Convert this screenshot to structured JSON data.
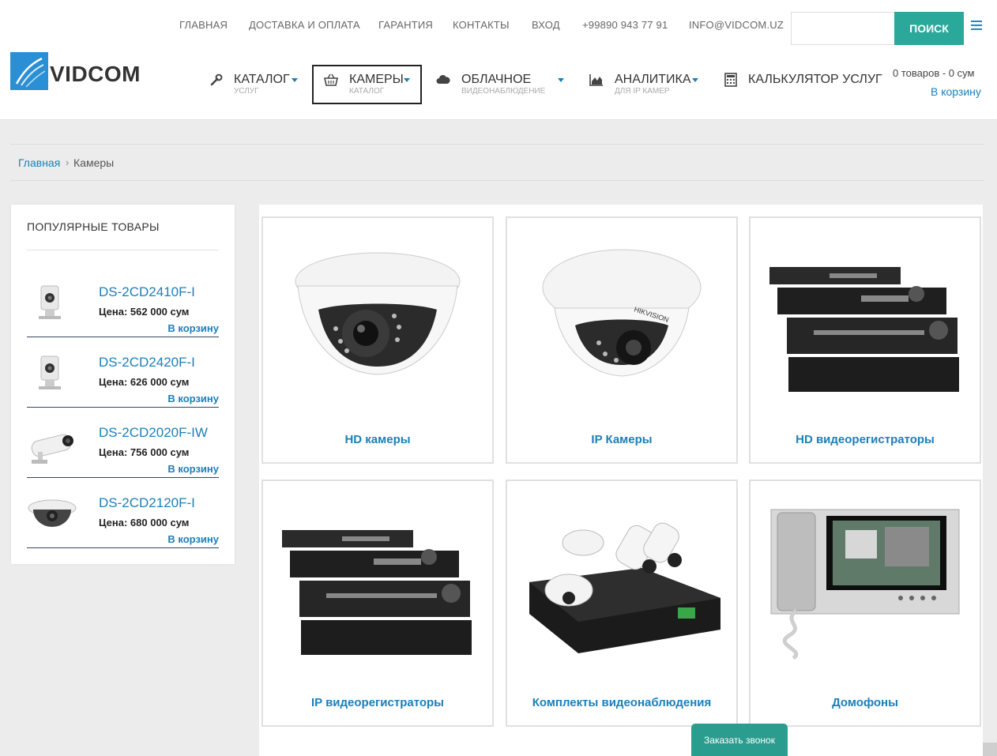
{
  "topnav": {
    "home": "ГЛАВНАЯ",
    "delivery": "ДОСТАВКА И ОПЛАТА",
    "warranty": "ГАРАНТИЯ",
    "contacts": "КОНТАКТЫ",
    "login": "ВХОД",
    "phone": "+99890 943 77 91",
    "email": "INFO@VIDCOM.UZ"
  },
  "search": {
    "placeholder": "",
    "button": "ПОИСК"
  },
  "logo": {
    "text": "VIDCOM"
  },
  "mainnav": {
    "catalog": {
      "label": "КАТАЛОГ",
      "sub": "УСЛУГ",
      "icon": "wrench-icon"
    },
    "cameras": {
      "label": "КАМЕРЫ",
      "sub": "КАТАЛОГ",
      "icon": "basket-icon"
    },
    "cloud": {
      "label": "ОБЛАЧНОЕ",
      "sub": "ВИДЕОНАБЛЮДЕНИЕ",
      "icon": "cloud-icon"
    },
    "analytics": {
      "label": "АНАЛИТИКА",
      "sub": "ДЛЯ IP КАМЕР",
      "icon": "area-chart-icon"
    },
    "calculator": {
      "label": "КАЛЬКУЛЯТОР УСЛУГ",
      "icon": "calculator-icon"
    }
  },
  "cart": {
    "summary": "0  товаров - 0 сум",
    "link": "В корзину"
  },
  "breadcrumb": {
    "home": "Главная",
    "separator": "›",
    "current": "Камеры"
  },
  "sidebar": {
    "title": "ПОПУЛЯРНЫЕ ТОВАРЫ",
    "products": [
      {
        "name": "DS-2CD2410F-I",
        "price": "Цена: 562 000 сум",
        "cart": "В корзину"
      },
      {
        "name": "DS-2CD2420F-I",
        "price": "Цена: 626 000 сум",
        "cart": "В корзину"
      },
      {
        "name": "DS-2CD2020F-IW",
        "price": "Цена: 756 000 сум",
        "cart": "В корзину"
      },
      {
        "name": "DS-2CD2120F-I",
        "price": "Цена: 680 000 сум",
        "cart": "В корзину"
      }
    ]
  },
  "categories": [
    {
      "label": "HD камеры"
    },
    {
      "label": "IP Камеры"
    },
    {
      "label": "HD видеорегистраторы"
    },
    {
      "label": "IP видеорегистраторы"
    },
    {
      "label": "Комплекты видеонаблюдения"
    },
    {
      "label": "Домофоны"
    }
  ],
  "callback": {
    "label": "Заказать звонок"
  },
  "colors": {
    "accent": "#2aa89a",
    "link": "#1b7fb8",
    "logo": "#2a8fd4"
  }
}
